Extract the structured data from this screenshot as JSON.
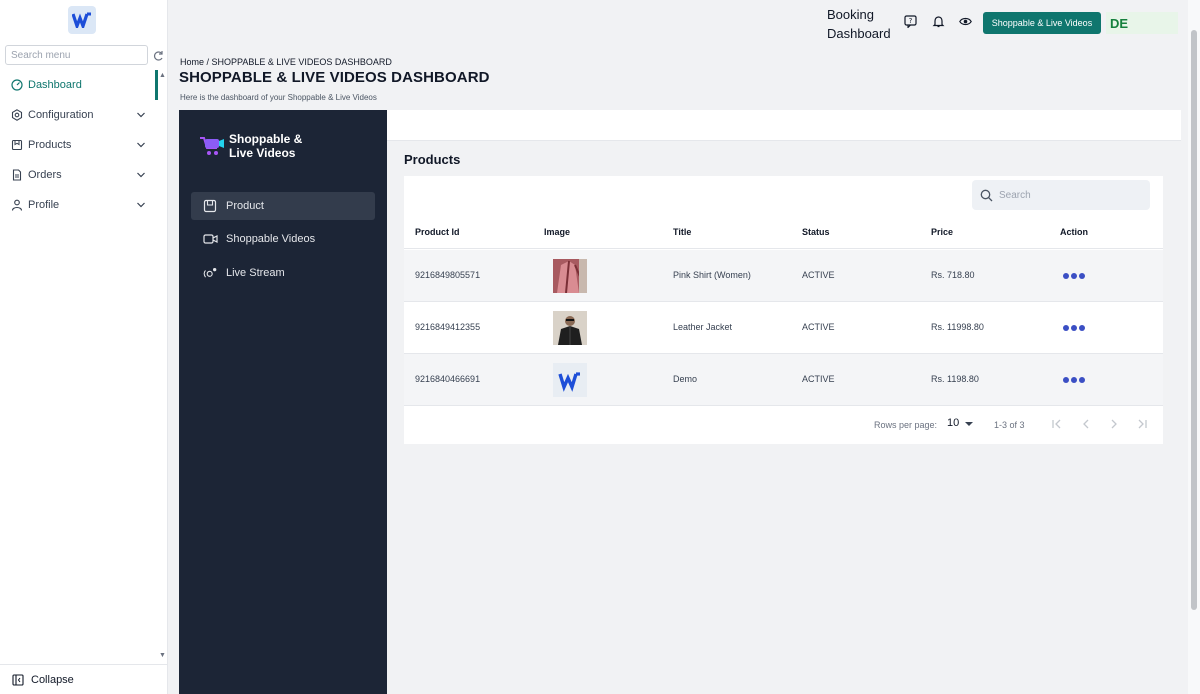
{
  "sidebar": {
    "search_placeholder": "Search menu",
    "items": [
      {
        "label": "Dashboard"
      },
      {
        "label": "Configuration"
      },
      {
        "label": "Products"
      },
      {
        "label": "Orders"
      },
      {
        "label": "Profile"
      }
    ],
    "collapse_label": "Collapse"
  },
  "header": {
    "title_line1": "Booking",
    "title_line2": "Dashboard",
    "app_button": "Shoppable & Live Videos",
    "user_initials": "DE"
  },
  "page": {
    "breadcrumb": "Home / SHOPPABLE & LIVE VIDEOS DASHBOARD",
    "title": "SHOPPABLE & LIVE VIDEOS DASHBOARD",
    "subtitle": "Here is the dashboard of your Shoppable & Live Videos"
  },
  "panel": {
    "brand_line1": "Shoppable &",
    "brand_line2": "Live Videos",
    "nav": [
      {
        "label": "Product"
      },
      {
        "label": "Shoppable Videos"
      },
      {
        "label": "Live Stream"
      }
    ]
  },
  "products": {
    "section_title": "Products",
    "search_placeholder": "Search",
    "columns": [
      "Product Id",
      "Image",
      "Title",
      "Status",
      "Price",
      "Action"
    ],
    "rows": [
      {
        "id": "9216849805571",
        "title": "Pink Shirt (Women)",
        "status": "ACTIVE",
        "price": "Rs. 718.80"
      },
      {
        "id": "9216849412355",
        "title": "Leather Jacket",
        "status": "ACTIVE",
        "price": "Rs. 11998.80"
      },
      {
        "id": "9216840466691",
        "title": "Demo",
        "status": "ACTIVE",
        "price": "Rs. 1198.80"
      }
    ],
    "pagination": {
      "rows_per_page_label": "Rows per page:",
      "rows_per_page": "10",
      "range": "1-3 of 3"
    }
  },
  "colors": {
    "accent": "#0f766e",
    "panel_bg": "#1c2536",
    "action_dots": "#3b4fc4"
  }
}
